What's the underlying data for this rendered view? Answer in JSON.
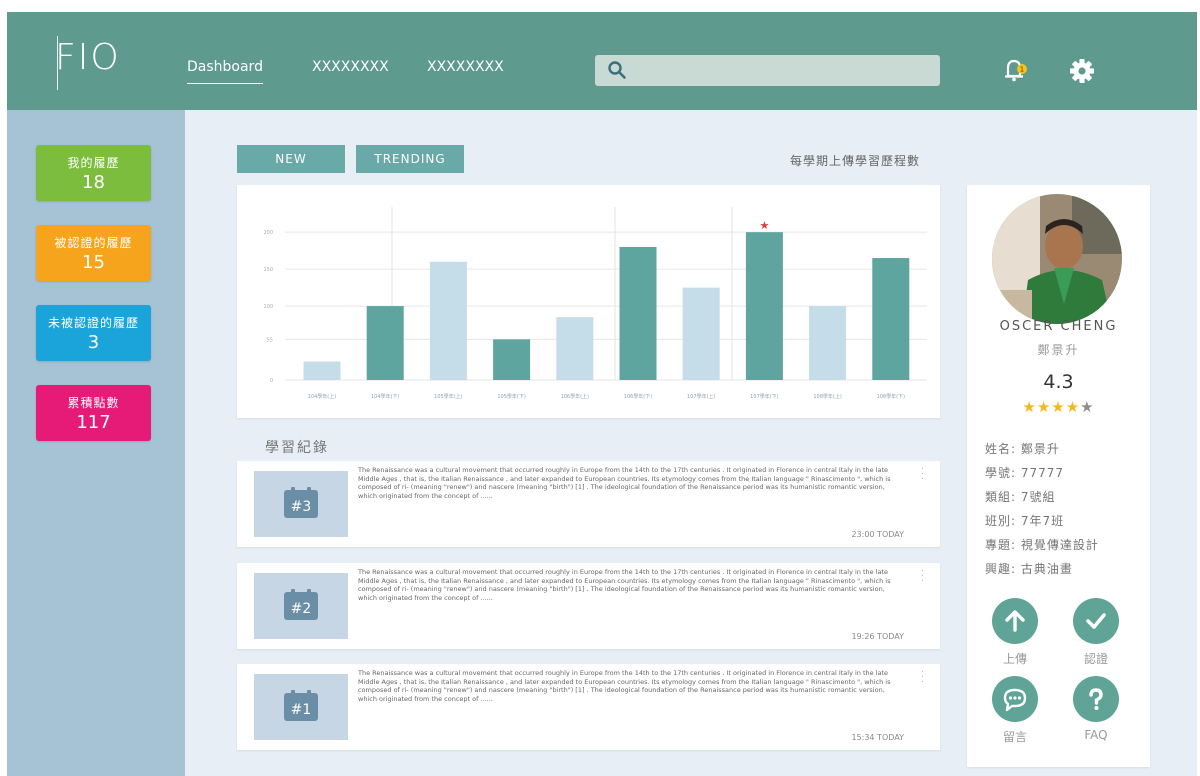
{
  "header": {
    "logo": "FIO",
    "nav": [
      "Dashboard",
      "XXXXXXXX",
      "XXXXXXXX"
    ],
    "search": {
      "placeholder": "",
      "value": ""
    },
    "notification_count": "1"
  },
  "sidebar": {
    "stats": [
      {
        "label": "我的履歷",
        "value": "18",
        "color": "#7cbd3e"
      },
      {
        "label": "被認證的履歷",
        "value": "15",
        "color": "#f6a41c"
      },
      {
        "label": "未被認證的履歷",
        "value": "3",
        "color": "#1ba4da"
      },
      {
        "label": "累積點數",
        "value": "117",
        "color": "#e61b78"
      }
    ]
  },
  "tabs": [
    {
      "label": "NEW"
    },
    {
      "label": "TRENDING"
    }
  ],
  "chart_link": "每學期上傳學習歷程數",
  "chart_data": {
    "type": "bar",
    "categories": [
      "104學年(上)",
      "104學年(下)",
      "105學年(上)",
      "105學年(下)",
      "106學年(上)",
      "106學年(下)",
      "107學年(上)",
      "107學年(下)",
      "108學年(上)",
      "108學年(下)"
    ],
    "values": [
      25,
      100,
      160,
      55,
      85,
      180,
      125,
      200,
      100,
      165
    ],
    "colors": [
      "#c4dde9",
      "#5fa59f",
      "#c4dde9",
      "#5fa59f",
      "#c4dde9",
      "#5fa59f",
      "#c4dde9",
      "#5fa59f",
      "#c4dde9",
      "#5fa59f"
    ],
    "highlight_index": 7,
    "y_ticks": [
      "0",
      "55",
      "100",
      "150",
      "200"
    ],
    "ylim": [
      0,
      230
    ]
  },
  "records_title": "學習紀錄",
  "records": [
    {
      "num": "#3",
      "text": "The Renaissance was a cultural movement that occurred roughly in Europe from the 14th to the 17th centuries . It originated in Florence in central Italy in the late Middle Ages , that is, the Italian Renaissance , and later expanded to European countries. Its etymology comes from the Italian language \" Rinascimento \", which is composed of ri- (meaning \"renew\") and nascere (meaning \"birth\") [1] . The ideological foundation of the Renaissance period was its humanistic romantic version, which originated from the concept of ......",
      "time": "23:00  TODAY"
    },
    {
      "num": "#2",
      "text": "The Renaissance was a cultural movement that occurred roughly in Europe from the 14th to the 17th centuries . It originated in Florence in central Italy in the late Middle Ages , that is, the Italian Renaissance , and later expanded to European countries. Its etymology comes from the Italian language \" Rinascimento \", which is composed of ri- (meaning \"renew\") and nascere (meaning \"birth\") [1] . The ideological foundation of the Renaissance period was its humanistic romantic version, which originated from the concept of ......",
      "time": "19:26  TODAY"
    },
    {
      "num": "#1",
      "text": "The Renaissance was a cultural movement that occurred roughly in Europe from the 14th to the 17th centuries . It originated in Florence in central Italy in the late Middle Ages , that is, the Italian Renaissance , and later expanded to European countries. Its etymology comes from the Italian language \" Rinascimento \", which is composed of ri- (meaning \"renew\") and nascere (meaning \"birth\") [1] . The ideological foundation of the Renaissance period was its humanistic romantic version, which originated from the concept of ......",
      "time": "15:34  TODAY"
    }
  ],
  "profile": {
    "name_en": "OSCER CHENG",
    "name_cn": "鄭景升",
    "rating": "4.3",
    "stars_filled": 4,
    "stars_total": 5,
    "info": [
      "姓名: 鄭景升",
      "學號: 77777",
      "類組: 7號組",
      "班別: 7年7班",
      "專題: 視覺傳達設計",
      "興趣: 古典油畫"
    ],
    "actions": [
      {
        "label": "上傳",
        "icon": "upload-arrow-icon"
      },
      {
        "label": "認證",
        "icon": "check-icon"
      },
      {
        "label": "留言",
        "icon": "chat-bubble-icon"
      },
      {
        "label": "FAQ",
        "icon": "question-icon"
      }
    ]
  }
}
